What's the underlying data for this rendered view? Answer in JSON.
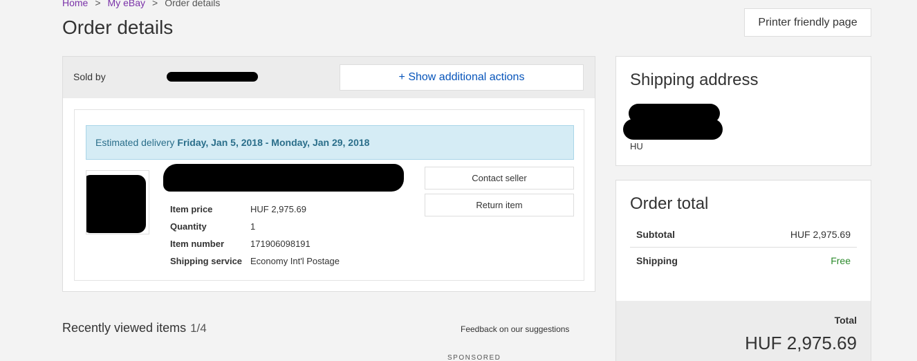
{
  "breadcrumb": {
    "home": "Home",
    "sep1": ">",
    "myebay": "My eBay",
    "sep2": ">",
    "current": "Order details"
  },
  "page_title": "Order details",
  "printer_button": "Printer friendly page",
  "order": {
    "sold_by_label": "Sold by",
    "show_actions": "+ Show additional actions",
    "delivery_label": "Estimated delivery",
    "delivery_range": "Friday, Jan 5, 2018 - Monday, Jan 29, 2018",
    "details": [
      {
        "label": "Item price",
        "value": "HUF 2,975.69"
      },
      {
        "label": "Quantity",
        "value": "1"
      },
      {
        "label": "Item number",
        "value": "171906098191"
      },
      {
        "label": "Shipping service",
        "value": "Economy Int'l Postage"
      }
    ],
    "contact_seller": "Contact seller",
    "return_item": "Return item"
  },
  "recent": {
    "title": "Recently viewed items",
    "count": "1/4",
    "feedback": "Feedback on our suggestions",
    "sponsored": "SPONSORED"
  },
  "shipping_address": {
    "heading": "Shipping address",
    "country": "HU"
  },
  "order_total": {
    "heading": "Order total",
    "subtotal_label": "Subtotal",
    "subtotal_value": "HUF 2,975.69",
    "shipping_label": "Shipping",
    "shipping_value": "Free",
    "total_label": "Total",
    "total_value": "HUF 2,975.69"
  },
  "colors": {
    "link_purple": "#7a32a8",
    "action_blue": "#0654ba",
    "delivery_bg": "#d5ecf5",
    "free_green": "#2b8a2b"
  }
}
